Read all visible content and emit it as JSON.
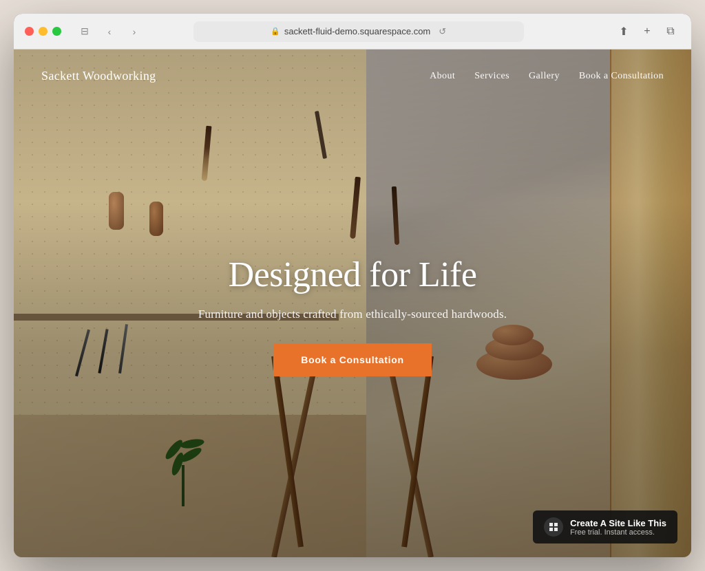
{
  "browser": {
    "url": "sackett-fluid-demo.squarespace.com",
    "back_label": "‹",
    "forward_label": "›",
    "reload_label": "↺",
    "share_label": "⬆",
    "new_tab_label": "+",
    "window_label": "⧉"
  },
  "nav": {
    "logo": "Sackett Woodworking",
    "links": [
      {
        "label": "About",
        "id": "nav-about"
      },
      {
        "label": "Services",
        "id": "nav-services"
      },
      {
        "label": "Gallery",
        "id": "nav-gallery"
      },
      {
        "label": "Book a Consultation",
        "id": "nav-book"
      }
    ]
  },
  "hero": {
    "title": "Designed for Life",
    "subtitle": "Furniture and objects crafted from ethically-sourced hardwoods.",
    "cta_label": "Book a Consultation"
  },
  "badge": {
    "title": "Create A Site Like This",
    "subtitle": "Free trial. Instant access.",
    "icon": "◈"
  }
}
